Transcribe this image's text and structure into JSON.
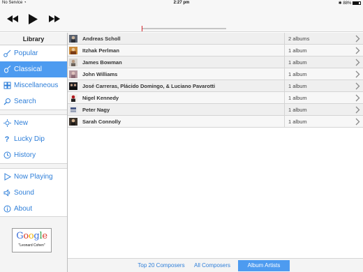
{
  "status_bar": {
    "carrier": "No Service",
    "time": "2:27 pm",
    "battery": "88%"
  },
  "transport": {
    "previous_icon": "rewind-icon",
    "play_icon": "play-icon",
    "next_icon": "fast-forward-icon"
  },
  "sidebar": {
    "header": "Library",
    "groups": [
      [
        {
          "label": "Popular",
          "icon": "guitar-icon"
        },
        {
          "label": "Classical",
          "icon": "violin-icon",
          "active": true
        },
        {
          "label": "Miscellaneous",
          "icon": "grid-icon"
        },
        {
          "label": "Search",
          "icon": "search-icon"
        }
      ],
      [
        {
          "label": "New",
          "icon": "sun-icon"
        },
        {
          "label": "Lucky Dip",
          "icon": "question-icon"
        },
        {
          "label": "History",
          "icon": "clock-icon"
        }
      ],
      [
        {
          "label": "Now Playing",
          "icon": "play-icon"
        },
        {
          "label": "Sound",
          "icon": "speaker-icon"
        },
        {
          "label": "About",
          "icon": "info-icon"
        }
      ]
    ],
    "promo": {
      "logo": "Google",
      "caption": "\"Leonard Cohen\""
    }
  },
  "artists": [
    {
      "name": "Andreas Scholl",
      "albums": "2 albums"
    },
    {
      "name": "Itzhak Perlman",
      "albums": "1 album"
    },
    {
      "name": "James Bowman",
      "albums": "1 album"
    },
    {
      "name": "John Williams",
      "albums": "1 album"
    },
    {
      "name": "José Carreras, Plácido Domingo, & Luciano Pavarotti",
      "albums": "1 album"
    },
    {
      "name": "Nigel Kennedy",
      "albums": "1 album"
    },
    {
      "name": "Peter Nagy",
      "albums": "1 album"
    },
    {
      "name": "Sarah Connolly",
      "albums": "1 album"
    }
  ],
  "bottom_tabs": [
    {
      "label": "Top 20 Composers"
    },
    {
      "label": "All Composers"
    },
    {
      "label": "Album Artists",
      "selected": true
    }
  ],
  "colors": {
    "accent": "#4d9bf0",
    "link": "#2f7fd9",
    "progress_marker": "#d8232a"
  }
}
